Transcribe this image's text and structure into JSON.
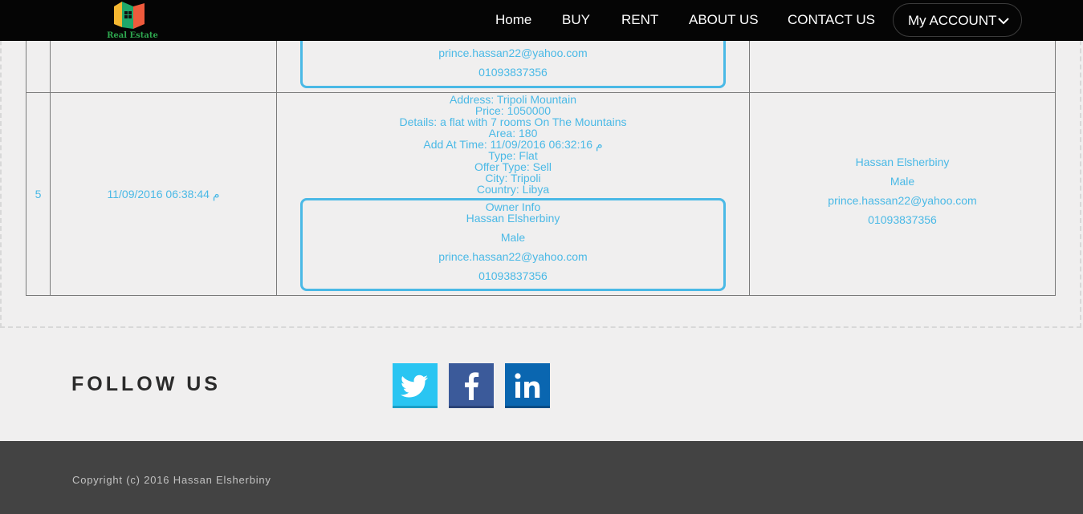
{
  "header": {
    "logo_text": "Real Estate",
    "nav": {
      "home": "Home",
      "buy": "BUY",
      "rent": "RENT",
      "about": "ABOUT US",
      "contact": "CONTACT US",
      "account": "My ACCOUNT"
    }
  },
  "table": {
    "prev_row": {
      "owner_email": "prince.hassan22@yahoo.com",
      "owner_phone": "01093837356"
    },
    "row": {
      "id": "5",
      "date": "11/09/2016 06:38:44 م",
      "details": [
        "Address: Tripoli Mountain",
        "Price: 1050000",
        "Details: a flat with 7 rooms On The Mountains",
        "Area: 180",
        "Add At Time: 11/09/2016 06:32:16 م",
        "Type: Flat",
        "Offer Type: Sell",
        "City: Tripoli",
        "Country: Libya"
      ],
      "owner_info_label": "Owner Info",
      "owner_name": "Hassan Elsherbiny",
      "owner_gender": "Male",
      "owner_email": "prince.hassan22@yahoo.com",
      "owner_phone": "01093837356",
      "user_name": "Hassan Elsherbiny",
      "user_gender": "Male",
      "user_email": "prince.hassan22@yahoo.com",
      "user_phone": "01093837356"
    }
  },
  "follow": {
    "title": "FOLLOW US",
    "icons": [
      "twitter-icon",
      "facebook-icon",
      "linkedin-icon"
    ]
  },
  "footer": {
    "copyright": "Copyright (c) 2016 Hassan Elsherbiny"
  },
  "colors": {
    "accent": "#4ab9e6",
    "navbar": "#050505",
    "footer": "#434343",
    "twitter": "#2ac5f2",
    "facebook": "#3b5a9a",
    "linkedin": "#0a66b0"
  }
}
